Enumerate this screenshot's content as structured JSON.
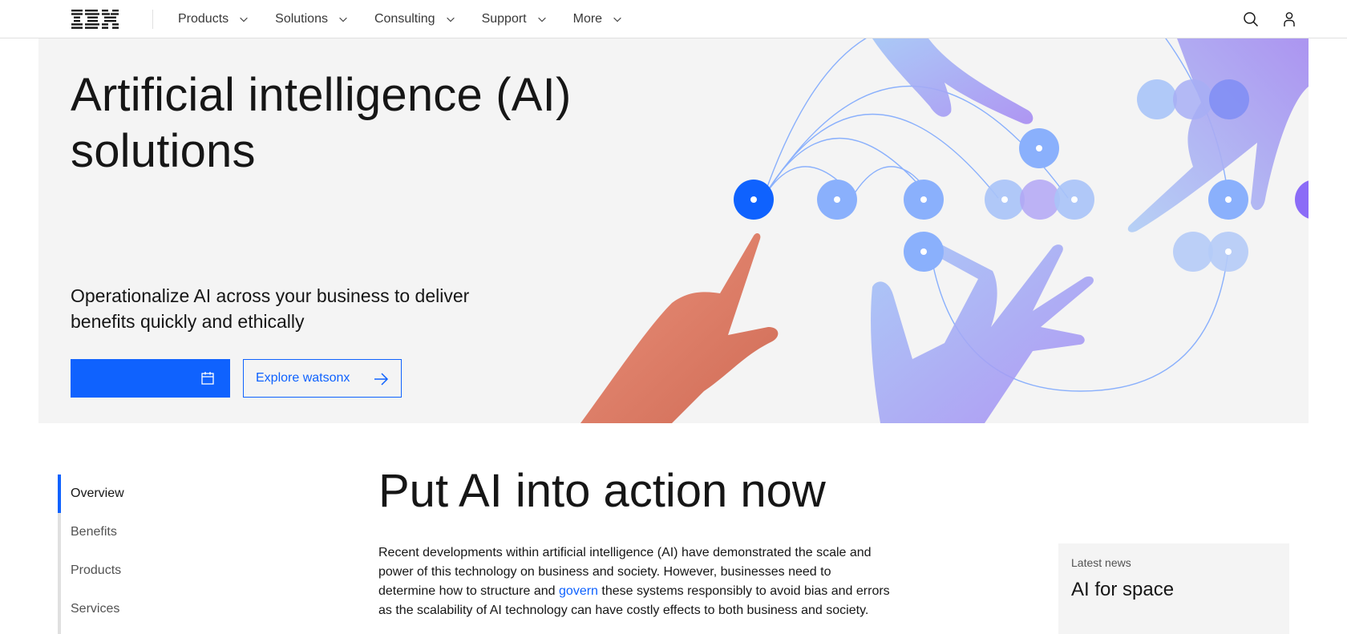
{
  "nav": {
    "logo": "IBM",
    "items": [
      {
        "label": "Products"
      },
      {
        "label": "Solutions"
      },
      {
        "label": "Consulting"
      },
      {
        "label": "Support"
      },
      {
        "label": "More"
      }
    ],
    "icons": {
      "search": "search-icon",
      "user": "user-icon",
      "chevron": "chevron-down-icon"
    }
  },
  "hero": {
    "title_line1": "Artificial intelligence (AI)",
    "title_line2": "solutions",
    "subtitle": "Operationalize AI across your business to deliver benefits quickly and ethically",
    "primary_button": {
      "label": "",
      "icon": "calendar-icon"
    },
    "secondary_button": {
      "label": "Explore watsonx",
      "icon": "arrow-right-icon"
    },
    "colors": {
      "background": "#f4f4f4",
      "accent": "#0f62fe",
      "node_active": "#0f62fe",
      "node": "#8ab0fc",
      "hand_pointing": "#e0866f",
      "hand_purple": "#a98ff5"
    }
  },
  "toc": {
    "items": [
      {
        "label": "Overview",
        "active": true
      },
      {
        "label": "Benefits",
        "active": false
      },
      {
        "label": "Products",
        "active": false
      },
      {
        "label": "Services",
        "active": false
      }
    ]
  },
  "section": {
    "title": "Put AI into action now",
    "body_before_link": "Recent developments within artificial intelligence (AI) have demonstrated the scale and power of this technology on business and society. However, businesses need to determine how to structure and ",
    "body_link": "govern",
    "body_after_link": " these systems responsibly to avoid bias and errors as the scalability of AI technology can have costly effects to both business and society."
  },
  "news": {
    "label": "Latest news",
    "title": "AI for space"
  }
}
